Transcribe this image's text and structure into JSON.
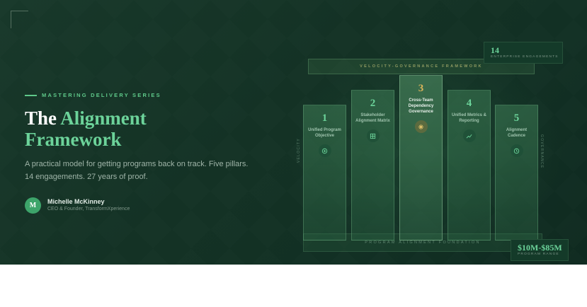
{
  "hero": {
    "kicker": "MASTERING DELIVERY SERIES",
    "title_lead": "The",
    "title_accent_1": "Alignment",
    "title_accent_2": "Framework",
    "description_1": "A practical model for getting programs back on track. Five pillars.",
    "description_2": "14 engagements. 27 years of proof."
  },
  "author": {
    "initial": "M",
    "name": "Michelle McKinney",
    "role": "CEO & Founder, TransformXperience"
  },
  "diagram": {
    "top_label": "VELOCITY-GOVERNANCE FRAMEWORK",
    "base_label": "PROGRAM ALIGNMENT FOUNDATION",
    "left_label": "VELOCITY",
    "right_label": "GOVERNANCE",
    "pillars": [
      {
        "number": "1",
        "label": "Unified Program Objective",
        "icon": "target-icon"
      },
      {
        "number": "2",
        "label": "Stakeholder Alignment Matrix",
        "icon": "grid-icon"
      },
      {
        "number": "3",
        "label": "Cross-Team Dependency Governance",
        "icon": "sparkle-icon"
      },
      {
        "number": "4",
        "label": "Unified Metrics & Reporting",
        "icon": "trend-chart-icon"
      },
      {
        "number": "5",
        "label": "Alignment Cadence",
        "icon": "clock-icon"
      }
    ]
  },
  "stats": {
    "engagements_value": "14",
    "engagements_label": "ENTERPRISE ENGAGEMENTS",
    "range_value": "$10M-$85M",
    "range_label": "PROGRAM RANGE"
  },
  "colors": {
    "accent": "#6cd39a",
    "gold": "#d9b45a",
    "background": "#143225"
  }
}
